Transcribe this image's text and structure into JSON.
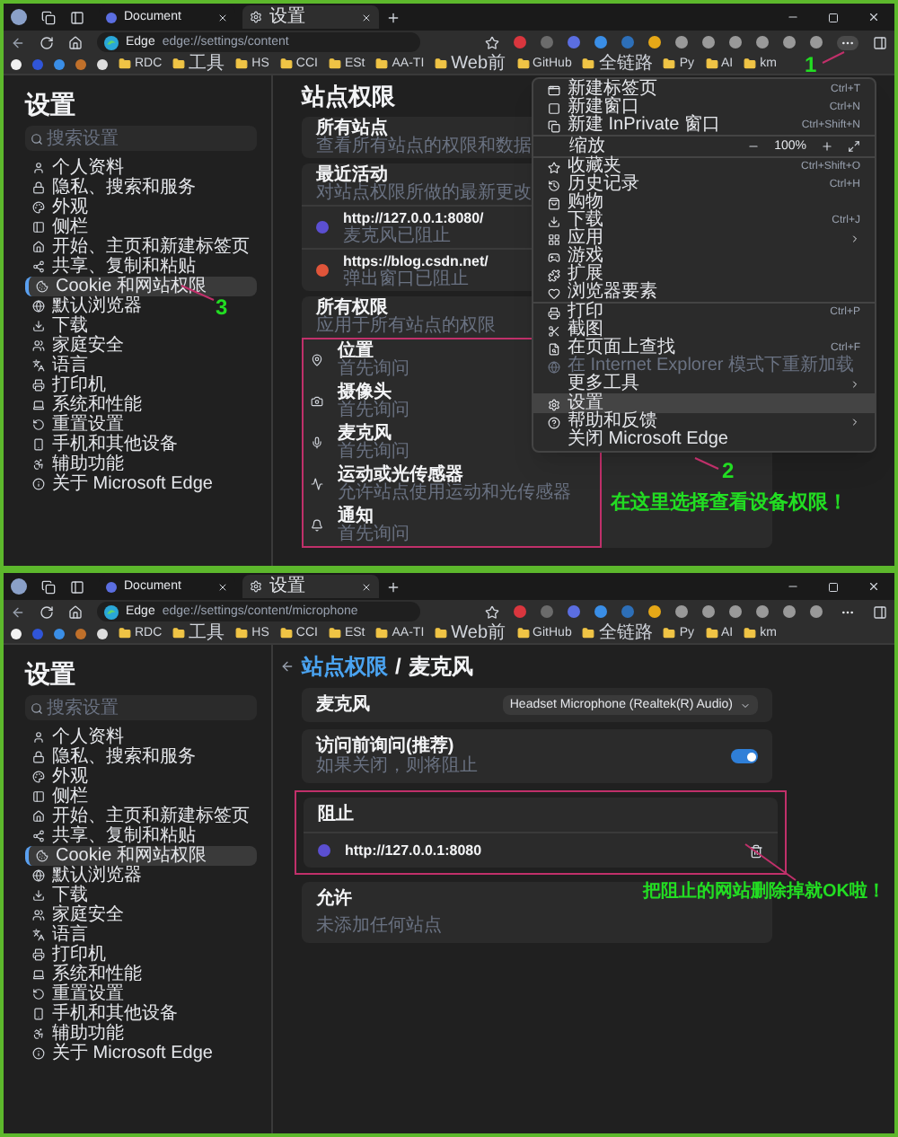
{
  "windows": [
    {
      "tabs": [
        {
          "label": "Document",
          "selected": false
        },
        {
          "label": "设置",
          "selected": true
        }
      ],
      "address": {
        "brand": "Edge",
        "url": "edge://settings/content"
      },
      "bookmarks": [
        "RDC",
        "工具",
        "HS",
        "CCI",
        "ESt",
        "AA-TI",
        "Web前",
        "GitHub",
        "全链路",
        "Py",
        "AI",
        "km"
      ],
      "sidebar": {
        "title": "设置",
        "search": {
          "placeholder": "搜索设置"
        },
        "items": [
          {
            "label": "个人资料",
            "selected": false
          },
          {
            "label": "隐私、搜索和服务",
            "selected": false
          },
          {
            "label": "外观",
            "selected": false
          },
          {
            "label": "侧栏",
            "selected": false
          },
          {
            "label": "开始、主页和新建标签页",
            "selected": false
          },
          {
            "label": "共享、复制和粘贴",
            "selected": false
          },
          {
            "label": "Cookie 和网站权限",
            "selected": true
          },
          {
            "label": "默认浏览器",
            "selected": false
          },
          {
            "label": "下载",
            "selected": false
          },
          {
            "label": "家庭安全",
            "selected": false
          },
          {
            "label": "语言",
            "selected": false
          },
          {
            "label": "打印机",
            "selected": false
          },
          {
            "label": "系统和性能",
            "selected": false
          },
          {
            "label": "重置设置",
            "selected": false
          },
          {
            "label": "手机和其他设备",
            "selected": false
          },
          {
            "label": "辅助功能",
            "selected": false
          },
          {
            "label": "关于 Microsoft Edge",
            "selected": false
          }
        ]
      },
      "content": {
        "kind": "overview",
        "title": "站点权限",
        "all_sites": {
          "title": "所有站点",
          "description": "查看所有站点的权限和数据"
        },
        "recent": {
          "title": "最近活动",
          "description": "对站点权限所做的最新更改",
          "sites": [
            {
              "url": "http://127.0.0.1:8080/",
              "status": "麦克风已阻止",
              "color": "#5b4fd1"
            },
            {
              "url": "https://blog.csdn.net/",
              "status": "弹出窗口已阻止",
              "color": "#e0553a"
            }
          ]
        },
        "permissions": {
          "title": "所有权限",
          "description": "应用于所有站点的权限",
          "items": [
            {
              "label": "位置",
              "value": "首先询问"
            },
            {
              "label": "摄像头",
              "value": "首先询问"
            },
            {
              "label": "麦克风",
              "value": "首先询问"
            },
            {
              "label": "运动或光传感器",
              "value": "允许站点使用运动和光传感器"
            },
            {
              "label": "通知",
              "value": "首先询问"
            }
          ]
        }
      },
      "menu": {
        "groups": [
          [
            {
              "kind": "item",
              "label": "新建标签页",
              "shortcut": "Ctrl+T",
              "submenu": false,
              "selected": false,
              "disabled": false
            },
            {
              "kind": "item",
              "label": "新建窗口",
              "shortcut": "Ctrl+N",
              "submenu": false,
              "selected": false,
              "disabled": false
            },
            {
              "kind": "item",
              "label": "新建 InPrivate 窗口",
              "shortcut": "Ctrl+Shift+N",
              "submenu": false,
              "selected": false,
              "disabled": false
            }
          ],
          [
            {
              "kind": "zoom",
              "label": "缩放",
              "value": "100%"
            }
          ],
          [
            {
              "kind": "item",
              "label": "收藏夹",
              "shortcut": "Ctrl+Shift+O",
              "submenu": false,
              "selected": false,
              "disabled": false
            },
            {
              "kind": "item",
              "label": "历史记录",
              "shortcut": "Ctrl+H",
              "submenu": false,
              "selected": false,
              "disabled": false
            },
            {
              "kind": "item",
              "label": "购物",
              "submenu": false,
              "selected": false,
              "disabled": false
            },
            {
              "kind": "item",
              "label": "下载",
              "shortcut": "Ctrl+J",
              "submenu": false,
              "selected": false,
              "disabled": false
            },
            {
              "kind": "item",
              "label": "应用",
              "submenu": true,
              "selected": false,
              "disabled": false
            },
            {
              "kind": "item",
              "label": "游戏",
              "submenu": false,
              "selected": false,
              "disabled": false
            },
            {
              "kind": "item",
              "label": "扩展",
              "submenu": false,
              "selected": false,
              "disabled": false
            },
            {
              "kind": "item",
              "label": "浏览器要素",
              "submenu": false,
              "selected": false,
              "disabled": false
            }
          ],
          [
            {
              "kind": "item",
              "label": "打印",
              "shortcut": "Ctrl+P",
              "submenu": false,
              "selected": false,
              "disabled": false
            },
            {
              "kind": "item",
              "label": "截图",
              "submenu": false,
              "selected": false,
              "disabled": false
            },
            {
              "kind": "item",
              "label": "在页面上查找",
              "shortcut": "Ctrl+F",
              "submenu": false,
              "selected": false,
              "disabled": false
            },
            {
              "kind": "item",
              "label": "在 Internet Explorer 模式下重新加载",
              "submenu": false,
              "selected": false,
              "disabled": true
            },
            {
              "kind": "item",
              "label": "更多工具",
              "submenu": true,
              "selected": false,
              "disabled": false
            }
          ],
          [
            {
              "kind": "item",
              "label": "设置",
              "submenu": false,
              "selected": true,
              "disabled": false
            },
            {
              "kind": "item",
              "label": "帮助和反馈",
              "submenu": true,
              "selected": false,
              "disabled": false
            },
            {
              "kind": "item",
              "label": "关闭 Microsoft Edge",
              "submenu": false,
              "selected": false,
              "disabled": false
            }
          ]
        ]
      },
      "annotations": [
        {
          "text": "1"
        },
        {
          "text": "2"
        },
        {
          "text": "3"
        },
        {
          "text": "在这里选择查看设备权限！"
        }
      ]
    },
    {
      "tabs": [
        {
          "label": "Document",
          "selected": false
        },
        {
          "label": "设置",
          "selected": true
        }
      ],
      "address": {
        "brand": "Edge",
        "url": "edge://settings/content/microphone"
      },
      "bookmarks": [
        "RDC",
        "工具",
        "HS",
        "CCI",
        "ESt",
        "AA-TI",
        "Web前",
        "GitHub",
        "全链路",
        "Py",
        "AI",
        "km"
      ],
      "sidebar": {
        "title": "设置",
        "search": {
          "placeholder": "搜索设置"
        },
        "items": [
          {
            "label": "个人资料",
            "selected": false
          },
          {
            "label": "隐私、搜索和服务",
            "selected": false
          },
          {
            "label": "外观",
            "selected": false
          },
          {
            "label": "侧栏",
            "selected": false
          },
          {
            "label": "开始、主页和新建标签页",
            "selected": false
          },
          {
            "label": "共享、复制和粘贴",
            "selected": false
          },
          {
            "label": "Cookie 和网站权限",
            "selected": true
          },
          {
            "label": "默认浏览器",
            "selected": false
          },
          {
            "label": "下载",
            "selected": false
          },
          {
            "label": "家庭安全",
            "selected": false
          },
          {
            "label": "语言",
            "selected": false
          },
          {
            "label": "打印机",
            "selected": false
          },
          {
            "label": "系统和性能",
            "selected": false
          },
          {
            "label": "重置设置",
            "selected": false
          },
          {
            "label": "手机和其他设备",
            "selected": false
          },
          {
            "label": "辅助功能",
            "selected": false
          },
          {
            "label": "关于 Microsoft Edge",
            "selected": false
          }
        ]
      },
      "content": {
        "kind": "device",
        "breadcrumb": {
          "parent": "站点权限",
          "separator": "/",
          "current": "麦克风"
        },
        "device": {
          "label": "麦克风",
          "dropdown": "Headset Microphone (Realtek(R) Audio)"
        },
        "ask": {
          "title": "访问前询问(推荐)",
          "description": "如果关闭，则将阻止",
          "on": true
        },
        "blocked": {
          "title": "阻止",
          "sites": [
            {
              "url": "http://127.0.0.1:8080",
              "color": "#5b4fd1"
            }
          ]
        },
        "allowed": {
          "title": "允许",
          "empty": "未添加任何站点"
        }
      },
      "annotations": [
        {
          "text": "把阻止的网站删除掉就OK啦！"
        }
      ]
    }
  ]
}
